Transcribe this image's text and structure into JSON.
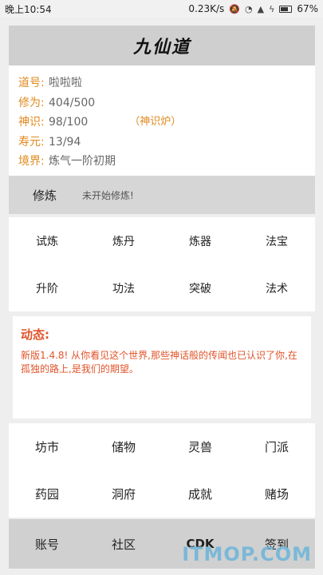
{
  "status_bar": {
    "time": "晚上10:54",
    "speed": "0.23K/s",
    "battery": "67%"
  },
  "header": {
    "logo_text": "九仙道"
  },
  "profile": {
    "rows": [
      {
        "label": "道号:",
        "value": "啦啦啦"
      },
      {
        "label": "修为:",
        "value": "404/500"
      },
      {
        "label": "神识:",
        "value": "98/100",
        "extra": "（神识炉）"
      },
      {
        "label": "寿元:",
        "value": "13/94"
      },
      {
        "label": "境界:",
        "value": "炼气一阶初期"
      }
    ]
  },
  "cultivate": {
    "title": "修炼",
    "status": "未开始修炼!"
  },
  "actions": [
    "试炼",
    "炼丹",
    "炼器",
    "法宝",
    "升阶",
    "功法",
    "突破",
    "法术"
  ],
  "news": {
    "title": "动态:",
    "text": "新版1.4.8! 从你看见这个世界,那些神话般的传闻也已认识了你,在孤独的路上,是我们的期望。"
  },
  "places": [
    "坊市",
    "储物",
    "灵兽",
    "门派",
    "药园",
    "洞府",
    "成就",
    "赌场"
  ],
  "bottom": [
    "账号",
    "社区",
    "CDK",
    "签到"
  ],
  "watermark": "ITMOP.COM",
  "colors": {
    "accent": "#e08a1e",
    "news": "#e0542a"
  }
}
